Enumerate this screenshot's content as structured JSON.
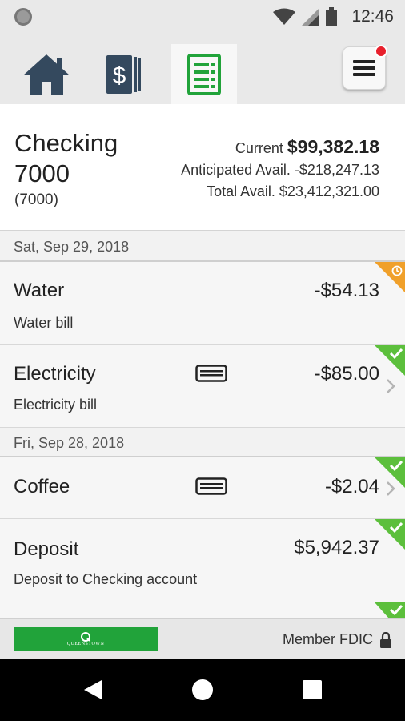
{
  "status_bar": {
    "time": "12:46",
    "icons": [
      "wifi-icon",
      "cell-signal-icon",
      "battery-icon"
    ]
  },
  "nav": {
    "tabs": [
      {
        "name": "home",
        "icon": "home-icon",
        "active": false
      },
      {
        "name": "accounts",
        "icon": "dollar-cards-icon",
        "active": false
      },
      {
        "name": "transactions",
        "icon": "ledger-icon",
        "active": true
      }
    ],
    "menu_icon": "hamburger-menu-icon",
    "menu_has_notification": true
  },
  "account": {
    "name": "Checking 7000",
    "number": "(7000)",
    "current_label": "Current",
    "current_value": "$99,382.18",
    "anticipated_label": "Anticipated Avail.",
    "anticipated_value": "-$218,247.13",
    "total_label": "Total Avail.",
    "total_value": "$23,412,321.00"
  },
  "groups": [
    {
      "date": "Sat, Sep 29, 2018",
      "transactions": [
        {
          "title": "Water",
          "description": "Water bill",
          "amount": "-$54.13",
          "status": "pending",
          "has_card": false,
          "has_chevron": false
        },
        {
          "title": "Electricity",
          "description": "Electricity bill",
          "amount": "-$85.00",
          "status": "cleared",
          "has_card": true,
          "has_chevron": true
        }
      ]
    },
    {
      "date": "Fri, Sep 28, 2018",
      "transactions": [
        {
          "title": "Coffee",
          "description": "",
          "amount": "-$2.04",
          "status": "cleared",
          "has_card": true,
          "has_chevron": true
        },
        {
          "title": "Deposit",
          "description": "Deposit to Checking account",
          "amount": "$5,942.37",
          "status": "cleared",
          "has_card": false,
          "has_chevron": false
        }
      ]
    }
  ],
  "footer": {
    "logo_text": "QUEENSTOWN",
    "fdic_label": "Member FDIC"
  },
  "colors": {
    "accent_green": "#21a33a",
    "cleared_green": "#5cbf3c",
    "pending_orange": "#f0a02a",
    "notification_red": "#e8202c"
  }
}
